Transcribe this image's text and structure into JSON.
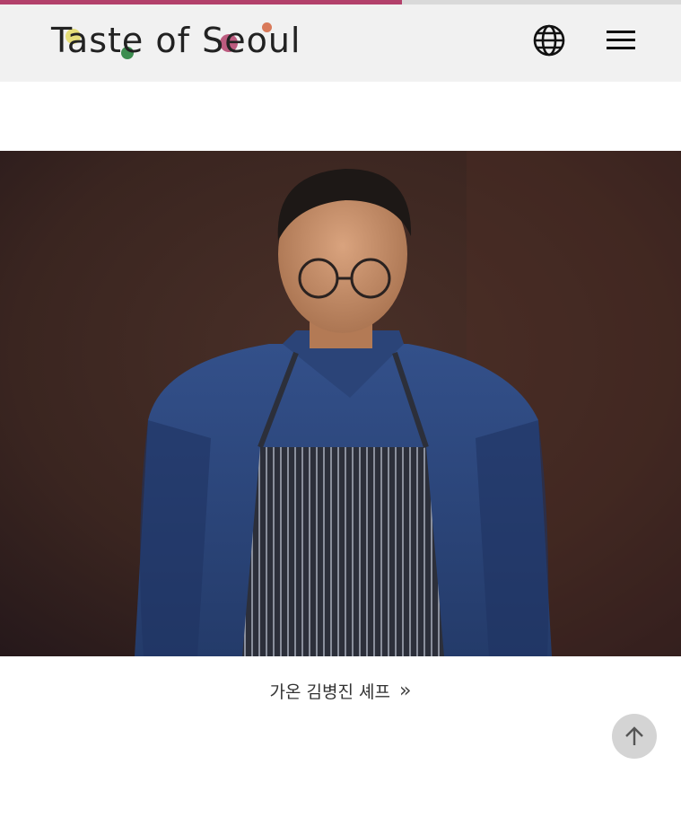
{
  "page": {
    "scroll_progress": 0.59
  },
  "header": {
    "logo_text": "Taste of Seoul",
    "logo_dot_colors": [
      "#d9d35a",
      "#3c8d4f",
      "#b3416b",
      "#d97a5a"
    ],
    "globe_icon": "globe-icon",
    "menu_icon": "hamburger-menu-icon"
  },
  "hero": {
    "image": "chef-portrait"
  },
  "caption": {
    "label": "가온 김병진 셰프",
    "arrow": "»"
  },
  "scroll_top": {
    "icon": "arrow-up-icon"
  },
  "colors": {
    "accent": "#b3416b",
    "header_bg": "#f1f1f1"
  }
}
